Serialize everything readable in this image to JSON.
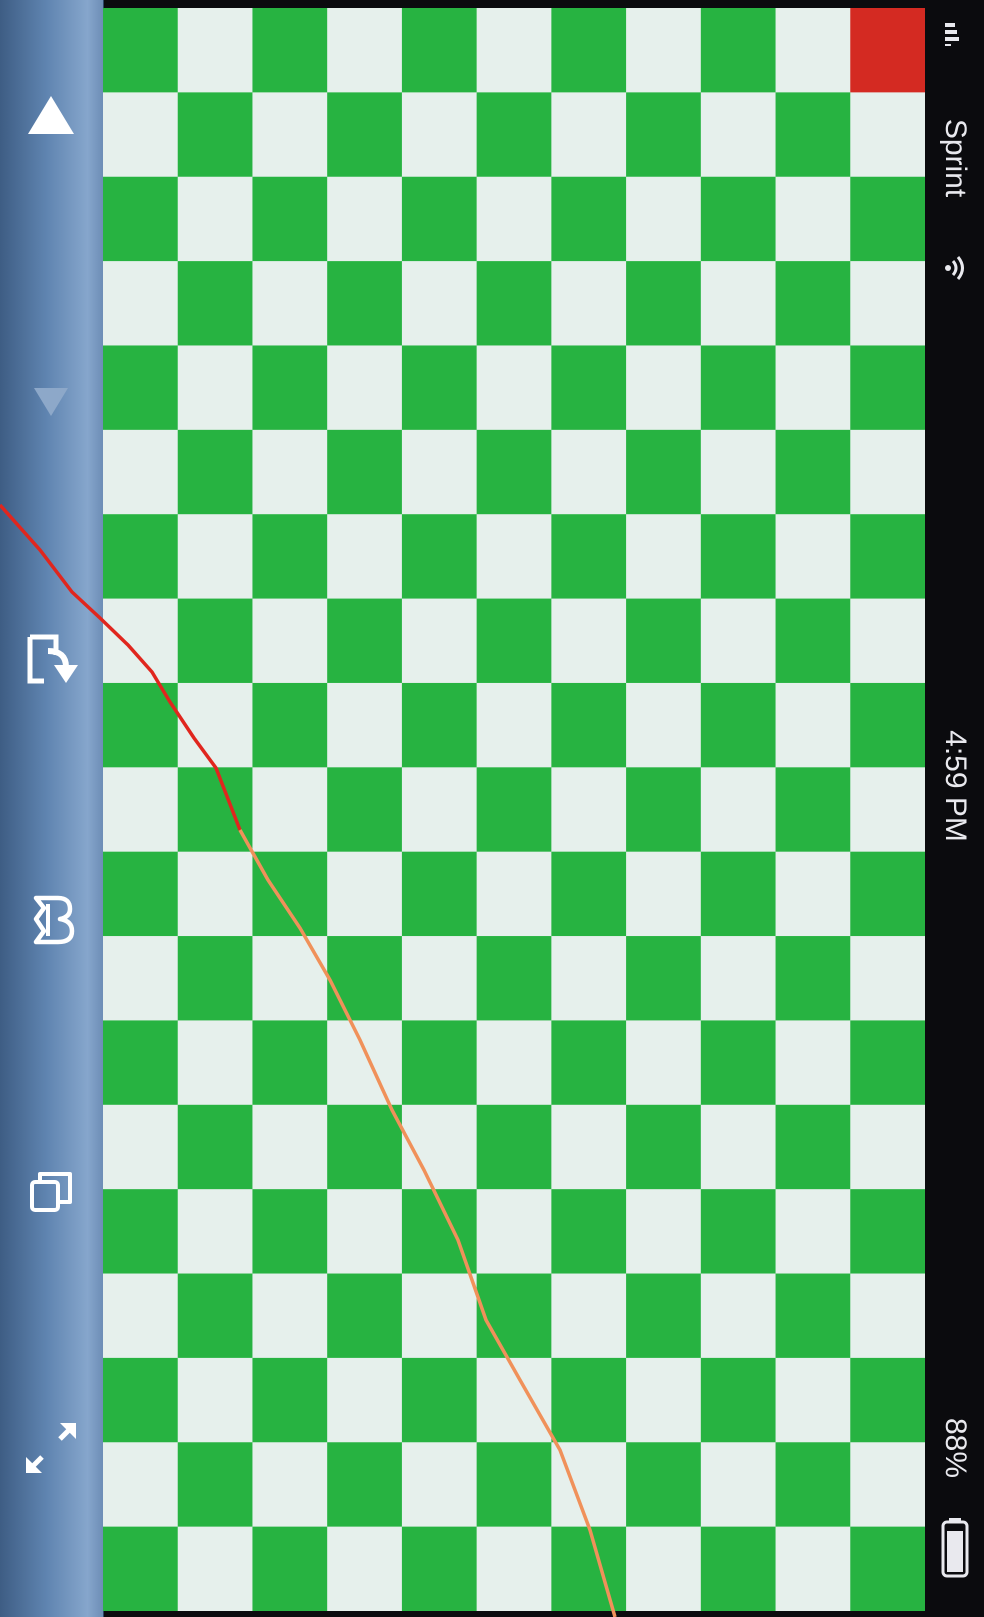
{
  "status_bar": {
    "carrier": "Sprint",
    "time": "4:59 PM",
    "battery": "88%",
    "signal_icon": "signal-bars-icon",
    "wifi_icon": "wifi-icon",
    "battery_icon": "battery-icon"
  },
  "toolbar": {
    "buttons": [
      {
        "name": "up-arrow-button",
        "icon": "triangle-up-icon",
        "enabled": true
      },
      {
        "name": "down-arrow-button",
        "icon": "triangle-down-icon",
        "enabled": false
      },
      {
        "name": "rotate-button",
        "icon": "rotate-page-icon",
        "enabled": true
      },
      {
        "name": "bookmark-button",
        "icon": "bookmark-b-icon",
        "enabled": true
      },
      {
        "name": "pages-button",
        "icon": "stacked-pages-icon",
        "enabled": true
      },
      {
        "name": "fullscreen-button",
        "icon": "expand-arrows-icon",
        "enabled": true
      }
    ]
  },
  "board": {
    "columns": 11,
    "rows": 19,
    "colors": {
      "green": "#27b341",
      "light": "#e6f0ec",
      "marker": "#d42a22"
    },
    "marker_cell": {
      "col": 10,
      "row": 0
    }
  },
  "overlay": {
    "trace_colors": {
      "red": "#e0261e",
      "orange": "#f0915a"
    }
  }
}
